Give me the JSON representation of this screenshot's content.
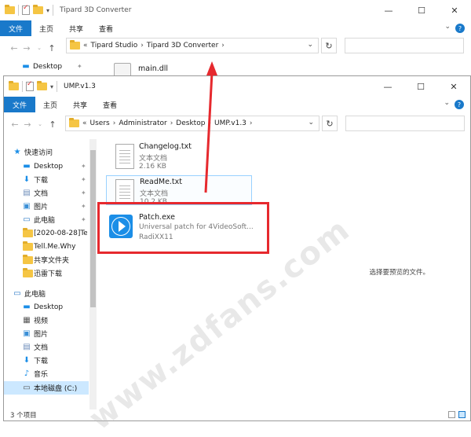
{
  "back_window": {
    "title": "Tipard 3D Converter",
    "ribbon": {
      "file": "文件",
      "home": "主页",
      "share": "共享",
      "view": "查看"
    },
    "crumbs": [
      "«",
      "Tipard Studio",
      "›",
      "Tipard 3D Converter",
      "›"
    ],
    "sidebar_item": "Desktop",
    "file": "main.dll"
  },
  "front_window": {
    "title": "UMP.v1.3",
    "ribbon": {
      "file": "文件",
      "home": "主页",
      "share": "共享",
      "view": "查看"
    },
    "crumbs": [
      "«",
      "Users",
      "›",
      "Administrator",
      "›",
      "Desktop",
      "›",
      "UMP.v1.3",
      "›"
    ],
    "sidebar": [
      {
        "label": "快速访问",
        "icon": "star-icon"
      },
      {
        "label": "Desktop",
        "icon": "desktop-icon",
        "pinned": true
      },
      {
        "label": "下载",
        "icon": "download-icon",
        "pinned": true
      },
      {
        "label": "文档",
        "icon": "document-icon",
        "pinned": true
      },
      {
        "label": "图片",
        "icon": "picture-icon",
        "pinned": true
      },
      {
        "label": "此电脑",
        "icon": "computer-icon",
        "pinned": true
      },
      {
        "label": "[2020-08-28]Te",
        "icon": "folder-icon"
      },
      {
        "label": "Tell.Me.Why",
        "icon": "folder-icon"
      },
      {
        "label": "共享文件夹",
        "icon": "folder-icon"
      },
      {
        "label": "迅雷下载",
        "icon": "folder-icon"
      },
      {
        "label": "此电脑",
        "icon": "computer-icon"
      },
      {
        "label": "Desktop",
        "icon": "desktop-icon"
      },
      {
        "label": "视频",
        "icon": "video-icon"
      },
      {
        "label": "图片",
        "icon": "picture-icon"
      },
      {
        "label": "文档",
        "icon": "document-icon"
      },
      {
        "label": "下载",
        "icon": "download-icon"
      },
      {
        "label": "音乐",
        "icon": "music-icon"
      },
      {
        "label": "本地磁盘 (C:)",
        "icon": "drive-icon"
      }
    ],
    "files": [
      {
        "name": "Changelog.txt",
        "type": "文本文档",
        "size": "2.16 KB"
      },
      {
        "name": "ReadMe.txt",
        "type": "文本文档",
        "size": "10.2 KB"
      },
      {
        "name": "Patch.exe",
        "desc": "Universal patch for 4VideoSoft...",
        "author": "RadiXX11"
      }
    ],
    "preview_text": "选择要预览的文件。",
    "status": "3 个项目"
  },
  "watermark": "www.zdfans.com",
  "colors": {
    "accent": "#1979ca",
    "highlight": "#e6292e",
    "selection": "#cce8ff"
  }
}
